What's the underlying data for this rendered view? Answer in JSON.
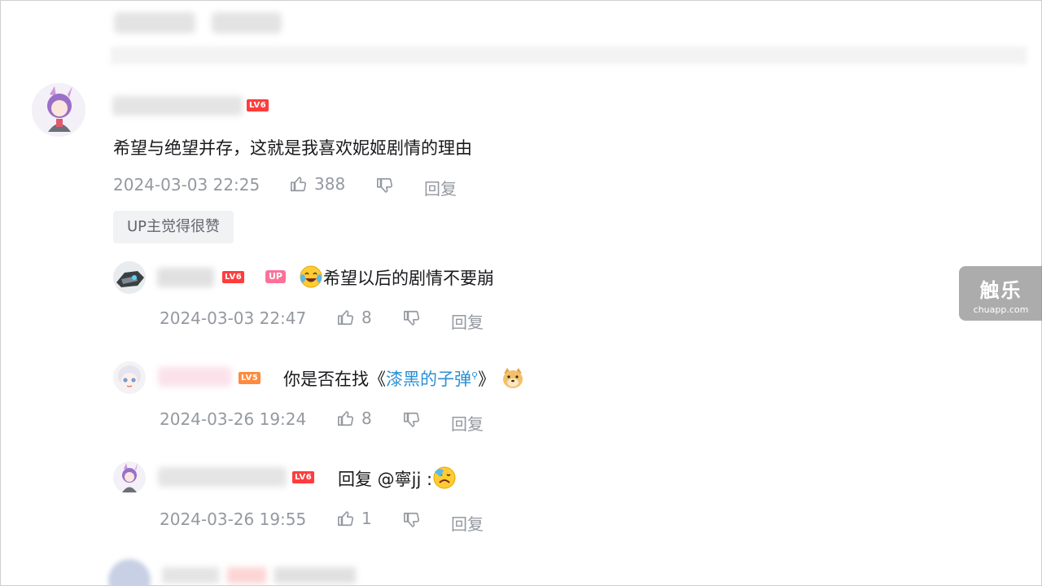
{
  "colors": {
    "meta_gray": "#9499a0",
    "link_blue": "#2a8fd6",
    "lv6_red": "#ff3d3d",
    "lv5_orange": "#ff8a3d",
    "up_pink": "#fb7299"
  },
  "main_comment": {
    "level": "LV6",
    "text": "希望与绝望并存，这就是我喜欢妮姬剧情的理由",
    "time": "2024-03-03 22:25",
    "likes": "388",
    "reply_label": "回复",
    "up_tag": "UP主觉得很赞"
  },
  "replies": [
    {
      "level": "LV6",
      "up_badge": "UP",
      "emoji": "crying-laughing-emoji",
      "text": "希望以后的剧情不要崩",
      "time": "2024-03-03 22:47",
      "likes": "8",
      "reply_label": "回复"
    },
    {
      "level": "LV5",
      "text_prefix": "你是否在找《",
      "link": "漆黑的子弹",
      "text_suffix": "》",
      "emoji": "doge-emoji",
      "time": "2024-03-26 19:24",
      "likes": "8",
      "reply_label": "回复"
    },
    {
      "level": "LV6",
      "text": "回复 @寧jj :",
      "emoji": "crying-emoji",
      "time": "2024-03-26 19:55",
      "likes": "1",
      "reply_label": "回复"
    }
  ],
  "watermark": {
    "title": "触乐",
    "url": "chuapp.com"
  }
}
